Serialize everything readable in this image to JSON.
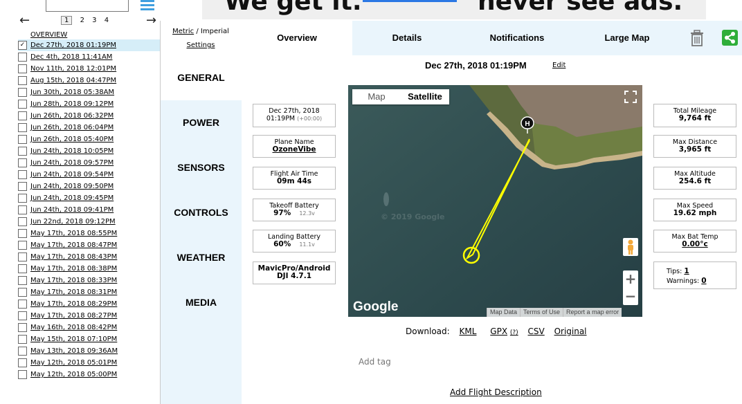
{
  "banner": {
    "left_text": "We get it.",
    "right_text": "never see ads."
  },
  "list": {
    "pages": [
      "1",
      "2",
      "3",
      "4"
    ],
    "overview_label": "OVERVIEW",
    "flights": [
      {
        "label": "Dec 27th, 2018 01:19PM",
        "checked": true
      },
      {
        "label": "Dec 4th, 2018 11:41AM"
      },
      {
        "label": "Nov 11th, 2018 12:01PM"
      },
      {
        "label": "Aug 15th, 2018 04:47PM"
      },
      {
        "label": "Jun 30th, 2018 05:38AM"
      },
      {
        "label": "Jun 28th, 2018 09:12PM"
      },
      {
        "label": "Jun 26th, 2018 06:32PM"
      },
      {
        "label": "Jun 26th, 2018 06:04PM"
      },
      {
        "label": "Jun 26th, 2018 05:40PM"
      },
      {
        "label": "Jun 24th, 2018 10:05PM"
      },
      {
        "label": "Jun 24th, 2018 09:57PM"
      },
      {
        "label": "Jun 24th, 2018 09:54PM"
      },
      {
        "label": "Jun 24th, 2018 09:50PM"
      },
      {
        "label": "Jun 24th, 2018 09:45PM"
      },
      {
        "label": "Jun 24th, 2018 09:41PM"
      },
      {
        "label": "Jun 22nd, 2018 09:12PM"
      },
      {
        "label": "May 17th, 2018 08:55PM"
      },
      {
        "label": "May 17th, 2018 08:47PM"
      },
      {
        "label": "May 17th, 2018 08:43PM"
      },
      {
        "label": "May 17th, 2018 08:38PM"
      },
      {
        "label": "May 17th, 2018 08:33PM"
      },
      {
        "label": "May 17th, 2018 08:31PM"
      },
      {
        "label": "May 17th, 2018 08:29PM"
      },
      {
        "label": "May 17th, 2018 08:27PM"
      },
      {
        "label": "May 16th, 2018 08:42PM"
      },
      {
        "label": "May 15th, 2018 07:10PM"
      },
      {
        "label": "May 13th, 2018 09:36AM"
      },
      {
        "label": "May 12th, 2018 05:01PM"
      },
      {
        "label": "May 12th, 2018 05:00PM"
      }
    ]
  },
  "units": {
    "metric": "Metric",
    "separator": " / ",
    "imperial": "Imperial",
    "settings": "Settings"
  },
  "tabs": [
    "Overview",
    "Details",
    "Notifications",
    "Large Map"
  ],
  "sidebar": [
    "GENERAL",
    "POWER",
    "SENSORS",
    "CONTROLS",
    "WEATHER",
    "MEDIA"
  ],
  "flight": {
    "title": "Dec 27th, 2018 01:19PM",
    "edit": "Edit",
    "date_line1": "Dec 27th, 2018",
    "date_line2": "01:19PM",
    "tz": "(+00:00)",
    "plane_label": "Plane Name",
    "plane_value": "OzoneVibe",
    "airtime_label": "Flight Air Time",
    "airtime_value": "09m 44s",
    "takeoff_label": "Takeoff Battery",
    "takeoff_value": "97%",
    "takeoff_volt": "12.3v",
    "landing_label": "Landing Battery",
    "landing_value": "60%",
    "landing_volt": "11.1v",
    "device_line1": "MavicPro/Android",
    "device_line2": "DJI 4.7.1",
    "mileage_label": "Total Mileage",
    "mileage_value": "9,764 ft",
    "distance_label": "Max Distance",
    "distance_value": "3,965 ft",
    "altitude_label": "Max Altitude",
    "altitude_value": "254.6 ft",
    "speed_label": "Max Speed",
    "speed_value": "19.62 mph",
    "battemp_label": "Max Bat Temp",
    "battemp_value": "0.00°c",
    "tips_label": "Tips:",
    "tips_value": "1",
    "warnings_label": "Warnings:",
    "warnings_value": "0"
  },
  "map": {
    "map_label": "Map",
    "satellite_label": "Satellite",
    "logo": "Google",
    "copyright": "© 2019 Google",
    "footer": [
      "Map Data",
      "Terms of Use",
      "Report a map error"
    ],
    "home_marker": "H",
    "path_color": "#ffff00"
  },
  "downloads": {
    "label": "Download:",
    "kml": "KML",
    "gpx": "GPX",
    "gpx_help": "(?)",
    "csv": "CSV",
    "original": "Original"
  },
  "tag_placeholder": "Add tag",
  "add_description": "Add Flight Description",
  "colors": {
    "accent": "#3f9fe0",
    "tab_bg": "#eaf5fc",
    "share": "#2fae3a",
    "selected_row": "#d6eef8"
  }
}
